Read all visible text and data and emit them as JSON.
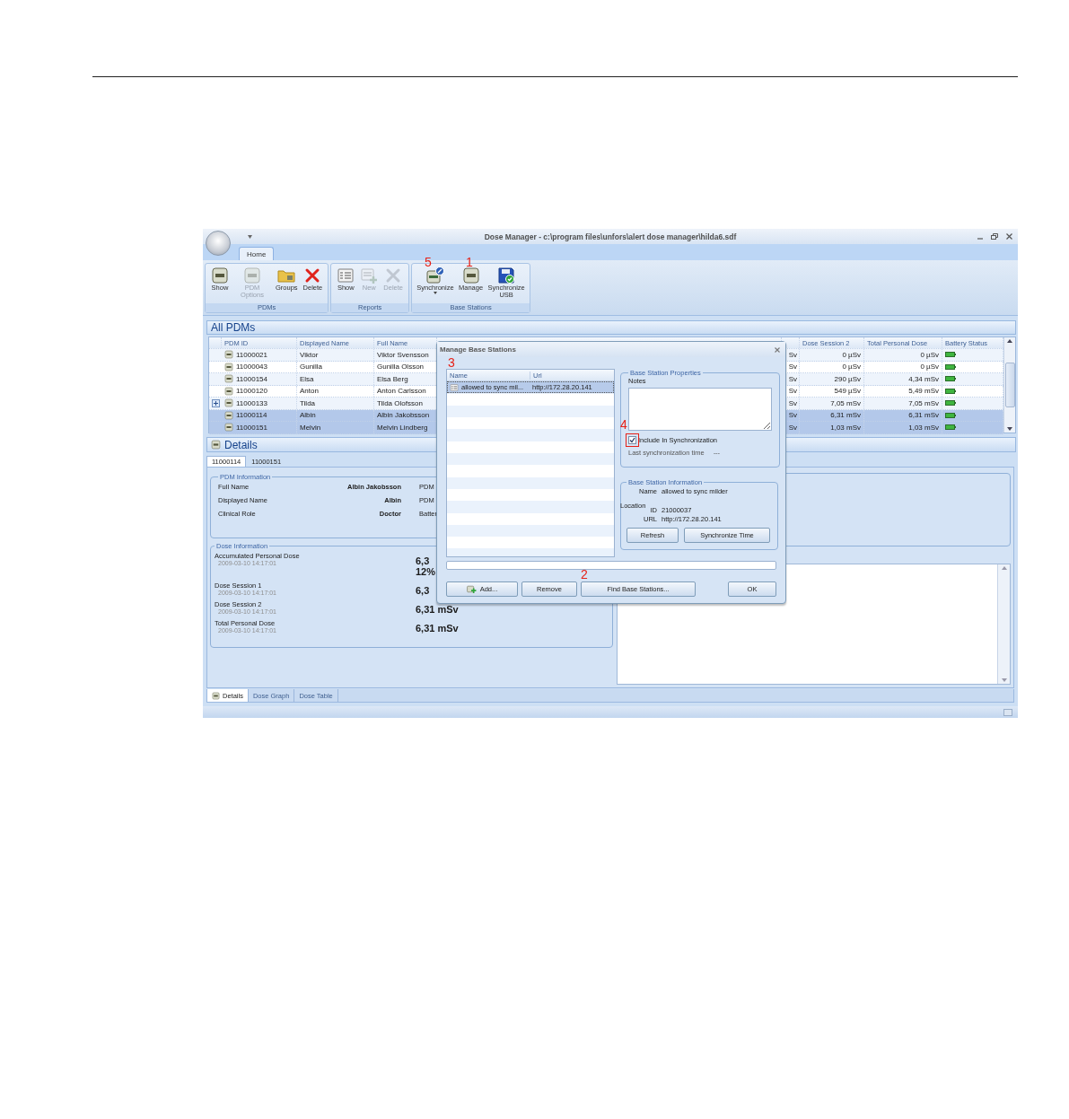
{
  "window": {
    "title": "Dose Manager - c:\\program files\\unfors\\alert dose manager\\hilda6.sdf"
  },
  "ribbon": {
    "tabs": [
      {
        "label": "Home",
        "selected": true
      }
    ],
    "groups": [
      {
        "label": "PDMs",
        "buttons": [
          {
            "label": "Show",
            "disabled": false,
            "dropdown": false
          },
          {
            "label": "PDM Options",
            "disabled": true,
            "dropdown": false
          },
          {
            "label": "Groups",
            "disabled": false,
            "dropdown": false
          },
          {
            "label": "Delete",
            "disabled": false,
            "dropdown": false
          }
        ]
      },
      {
        "label": "Reports",
        "buttons": [
          {
            "label": "Show",
            "disabled": false,
            "dropdown": false
          },
          {
            "label": "New",
            "disabled": true,
            "dropdown": false
          },
          {
            "label": "Delete",
            "disabled": true,
            "dropdown": false
          }
        ]
      },
      {
        "label": "Base Stations",
        "buttons": [
          {
            "label": "Synchronize",
            "disabled": false,
            "dropdown": true,
            "callout": "5"
          },
          {
            "label": "Manage",
            "disabled": false,
            "dropdown": false,
            "callout": "1"
          },
          {
            "label": "Synchronize USB",
            "disabled": false,
            "dropdown": false
          }
        ]
      }
    ]
  },
  "pdms": {
    "title": "All PDMs",
    "columns": [
      "PDM ID",
      "Displayed Name",
      "Full Name",
      "Dose Session 2",
      "Total Personal Dose",
      "Battery Status"
    ],
    "rows": [
      {
        "pdm_id": "11000021",
        "displayed_name": "Viktor",
        "full_name": "Viktor Svensson",
        "column_4": "Sv",
        "dose_session_2": "0 µSv",
        "total_personal_dose": "0 µSv",
        "expandable": false,
        "selected": false
      },
      {
        "pdm_id": "11000043",
        "displayed_name": "Gunilla",
        "full_name": "Gunilla Olsson",
        "column_4": "Sv",
        "dose_session_2": "0 µSv",
        "total_personal_dose": "0 µSv",
        "expandable": false,
        "selected": false
      },
      {
        "pdm_id": "11000154",
        "displayed_name": "Elsa",
        "full_name": "Elsa Berg",
        "column_4": "Sv",
        "dose_session_2": "290 µSv",
        "total_personal_dose": "4,34 mSv",
        "expandable": false,
        "selected": false
      },
      {
        "pdm_id": "11000120",
        "displayed_name": "Anton",
        "full_name": "Anton Carlsson",
        "column_4": "Sv",
        "dose_session_2": "549 µSv",
        "total_personal_dose": "5,49 mSv",
        "expandable": false,
        "selected": false
      },
      {
        "pdm_id": "11000133",
        "displayed_name": "Tilda",
        "full_name": "Tilda Olofsson",
        "column_4": "Sv",
        "dose_session_2": "7,05 mSv",
        "total_personal_dose": "7,05 mSv",
        "expandable": true,
        "selected": false
      },
      {
        "pdm_id": "11000114",
        "displayed_name": "Albin",
        "full_name": "Albin Jakobsson",
        "column_4": "Sv",
        "dose_session_2": "6,31 mSv",
        "total_personal_dose": "6,31 mSv",
        "expandable": false,
        "selected": true
      },
      {
        "pdm_id": "11000151",
        "displayed_name": "Melvin",
        "full_name": "Melvin Lindberg",
        "column_4": "Sv",
        "dose_session_2": "1,03 mSv",
        "total_personal_dose": "1,03 mSv",
        "expandable": false,
        "selected": true
      }
    ]
  },
  "details": {
    "title": "Details",
    "tabs": [
      {
        "label": "11000114",
        "selected": true
      },
      {
        "label": "11000151",
        "selected": false
      }
    ],
    "pdm_information": {
      "title": "PDM Information",
      "rows": [
        {
          "label": "Full Name",
          "value": "Albin Jakobsson",
          "label_2": "PDM"
        },
        {
          "label": "Displayed Name",
          "value": "Albin",
          "label_2": "PDM"
        },
        {
          "label": "Clinical Role",
          "value": "Doctor",
          "label_2": "Batter"
        }
      ]
    },
    "dose_information": {
      "title": "Dose Information",
      "rows": [
        {
          "label": "Accumulated Personal Dose",
          "time": "2009-03-10 14:17:01",
          "values": [
            "6,3",
            "12%"
          ]
        },
        {
          "label": "Dose Session 1",
          "time": "2009-03-10 14:17:01",
          "values": [
            "6,3"
          ]
        },
        {
          "label": "Dose Session 2",
          "time": "2009-03-10 14:17:01",
          "values": [
            "6,31 mSv"
          ]
        },
        {
          "label": "Total Personal Dose",
          "time": "2009-03-10 14:17:01",
          "values": [
            "6,31 mSv"
          ]
        }
      ]
    },
    "bottom_tabs": [
      {
        "label": "Details",
        "selected": true
      },
      {
        "label": "Dose Graph",
        "selected": false
      },
      {
        "label": "Dose Table",
        "selected": false
      }
    ]
  },
  "dialog": {
    "title": "Manage Base Stations",
    "list": {
      "callout": "3",
      "columns": [
        "Name",
        "Url"
      ],
      "rows": [
        {
          "name": "allowed to sync mil...",
          "url": "http://172.28.20.141",
          "selected": true
        }
      ]
    },
    "properties": {
      "title": "Base Station Properties",
      "notes_label": "Notes",
      "include": {
        "label": "Include In Synchronization",
        "checked": true,
        "callout": "4"
      },
      "last_sync_label": "Last synchronization time",
      "last_sync": "---"
    },
    "information": {
      "title": "Base Station Information",
      "fields": [
        {
          "label": "Name",
          "value": "allowed to sync milder"
        },
        {
          "label": "Location"
        },
        {
          "label": "ID",
          "value": "21000037"
        },
        {
          "label": "URL",
          "value": "http://172.28.20.141"
        }
      ],
      "buttons": [
        "Refresh",
        "Synchronize Time"
      ]
    },
    "progress": {
      "level": 0
    },
    "buttons": [
      {
        "label": "Add...",
        "kind": "add"
      },
      {
        "label": "Remove",
        "kind": "plain"
      },
      {
        "label": "Find Base Stations...",
        "kind": "plain",
        "callout": "2"
      },
      {
        "label": "OK",
        "kind": "plain"
      }
    ]
  }
}
